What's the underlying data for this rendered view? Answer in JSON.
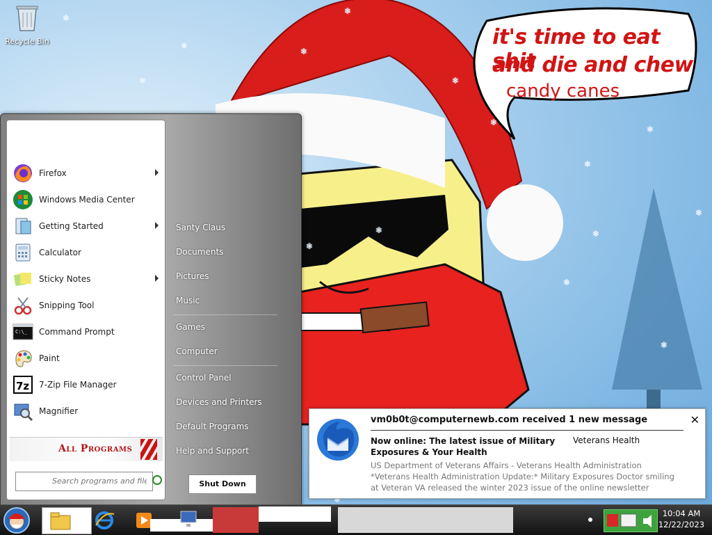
{
  "desktop": {
    "icons": [
      {
        "label": "Recycle Bin",
        "icon": "recycle-bin-icon"
      }
    ],
    "wallpaper_text": {
      "line1": "it's time to eat shit",
      "line2": "and die and chew",
      "line3": "candy canes"
    }
  },
  "start_menu": {
    "programs": [
      {
        "label": "Firefox",
        "icon": "firefox-icon",
        "submenu": true
      },
      {
        "label": "Windows Media Center",
        "icon": "windows-media-center-icon",
        "submenu": false
      },
      {
        "label": "Getting Started",
        "icon": "getting-started-icon",
        "submenu": true
      },
      {
        "label": "Calculator",
        "icon": "calculator-icon",
        "submenu": false
      },
      {
        "label": "Sticky Notes",
        "icon": "sticky-notes-icon",
        "submenu": true
      },
      {
        "label": "Snipping Tool",
        "icon": "snipping-tool-icon",
        "submenu": false
      },
      {
        "label": "Command Prompt",
        "icon": "command-prompt-icon",
        "submenu": false
      },
      {
        "label": "Paint",
        "icon": "paint-icon",
        "submenu": false
      },
      {
        "label": "7-Zip File Manager",
        "icon": "7zip-icon",
        "submenu": false
      },
      {
        "label": "Magnifier",
        "icon": "magnifier-icon",
        "submenu": false
      }
    ],
    "all_programs_label": "All Programs",
    "search_placeholder": "Search programs and files",
    "right_links": [
      "Santy Claus",
      "Documents",
      "Pictures",
      "Music",
      "Games",
      "Computer",
      "Control Panel",
      "Devices and Printers",
      "Default Programs",
      "Help and Support"
    ],
    "shutdown_label": "Shut Down"
  },
  "notification": {
    "app_icon": "thunderbird-icon",
    "title": "vm0b0t@computernewb.com received 1 new message",
    "subject": "Now online: The latest issue of Military Exposures & Your Health",
    "sender": "Veterans Health",
    "preview": "US Department of Veterans Affairs - Veterans Health Administration *Veterans Health Administration Update:* Military Exposures Doctor smiling at Veteran VA released the winter 2023 issue of the online newsletter \"Military Exposures & Your"
  },
  "taskbar": {
    "time": "10:04 AM",
    "date": "12/22/2023"
  },
  "colors": {
    "accent_red": "#c81414",
    "notification_text_muted": "#777777",
    "tray_green": "#3ea23e"
  }
}
